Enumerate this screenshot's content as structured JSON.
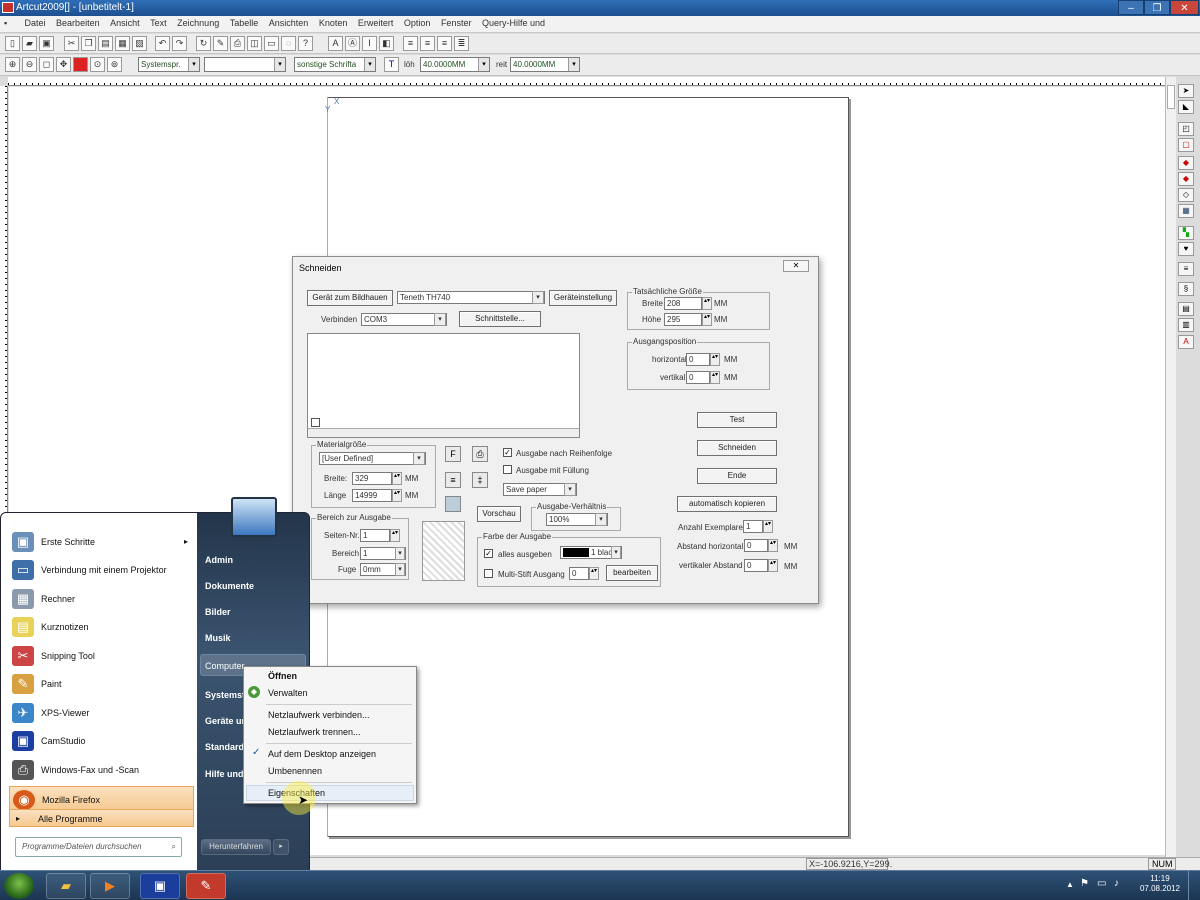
{
  "window": {
    "title": "Artcut2009[] - [unbetitelt-1]",
    "minimize": "–",
    "maximize": "❐",
    "close": "✕"
  },
  "menu": [
    "Datei",
    "Bearbeiten",
    "Ansicht",
    "Text",
    "Zeichnung",
    "Tabelle",
    "Ansichten",
    "Knoten",
    "Erweitert",
    "Option",
    "Fenster",
    "Query-Hilfe und"
  ],
  "toolbar2": {
    "font_system": "Systemspr.",
    "font_empty": "",
    "font_other": "sonstige Schrifta",
    "height_label": "löh",
    "height_value": "40.0000MM",
    "width_label": "reit",
    "width_value": "40.0000MM"
  },
  "statusbar": {
    "coords": "X=-106.9216,Y=299.",
    "num": "NUM"
  },
  "canvas": {
    "origin_x": "X",
    "origin_y": "Y"
  },
  "dialog": {
    "title": "Schneiden",
    "close": "✕",
    "btn_device": "Gerät zum Bildhauen",
    "device": "Teneth TH740",
    "btn_device_settings": "Geräteinstellung",
    "connect_label": "Verbinden",
    "connect_value": "COM3",
    "btn_interface": "Schnittstelle...",
    "actual_size": {
      "title": "Tatsächliche Größe",
      "width_label": "Breite",
      "width": "208",
      "height_label": "Höhe",
      "height": "295",
      "unit": "MM"
    },
    "start_pos": {
      "title": "Ausgangsposition",
      "horiz_label": "horizontal",
      "horiz": "0",
      "vert_label": "vertikal",
      "vert": "0",
      "unit": "MM"
    },
    "btn_test": "Test",
    "btn_cut": "Schneiden",
    "btn_end": "Ende",
    "material": {
      "title": "Materialgröße",
      "preset": "[User Defined]",
      "width_label": "Breite:",
      "width": "329",
      "length_label": "Länge",
      "length": "14999",
      "unit": "MM"
    },
    "output_order": "Ausgabe nach Reihenfolge",
    "output_fill": "Ausgabe mit Füllung",
    "save_paper": "Save paper",
    "range": {
      "title": "Bereich zur Ausgabe",
      "page_label": "Seiten-Nr.",
      "page": "1",
      "range_label": "Bereich",
      "range": "1",
      "joint_label": "Fuge",
      "joint": "0mm"
    },
    "btn_preview": "Vorschau",
    "ratio": {
      "title": "Ausgabe-Verhältnis",
      "value": "100%"
    },
    "color": {
      "title": "Farbe der Ausgabe",
      "all": "alles ausgeben",
      "color_name": "1 blac",
      "multi": "Multi-Stift Ausgang",
      "multi_val": "0",
      "btn_edit": "bearbeiten"
    },
    "auto_copy": "automatisch kopieren",
    "copies_label": "Anzahl Exemplare",
    "copies": "1",
    "hdist_label": "Abstand horizontal",
    "hdist": "0",
    "vdist_label": "vertikaler Abstand",
    "vdist": "0",
    "unit": "MM"
  },
  "startmenu": {
    "left": [
      "Erste Schritte",
      "Verbindung mit einem Projektor",
      "Rechner",
      "Kurznotizen",
      "Snipping Tool",
      "Paint",
      "XPS-Viewer",
      "CamStudio",
      "Windows-Fax und -Scan",
      "Mozilla Firefox"
    ],
    "all_programs": "Alle Programme",
    "search_placeholder": "Programme/Dateien durchsuchen",
    "right": [
      "Admin",
      "Dokumente",
      "Bilder",
      "Musik",
      "Computer",
      "Systemst",
      "Geräte ur",
      "Standard",
      "Hilfe und"
    ],
    "shutdown": "Herunterfahren"
  },
  "context": [
    "Öffnen",
    "Verwalten",
    "Netzlaufwerk verbinden...",
    "Netzlaufwerk trennen...",
    "Auf dem Desktop anzeigen",
    "Umbenennen",
    "Eigenschaften"
  ],
  "clock": {
    "time": "11:19",
    "date": "07.08.2012"
  }
}
